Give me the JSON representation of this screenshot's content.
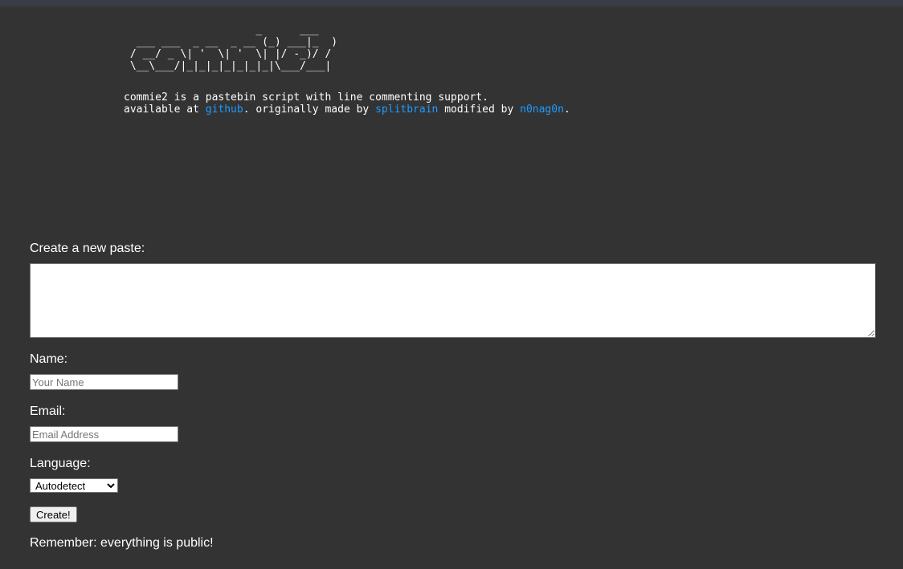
{
  "header": {
    "ascii_logo": "                     _      ___\n  ___ ___  _ __  _ __ (_) ___|_  )\n / __/ _ \\| '  \\| '  \\| |/ -_)/ /\n \\__\\___/|_|_|_|_|_|_|_|\\___/___|",
    "intro_line1": "commie2 is a pastebin script with line commenting support.",
    "intro_line2_prefix": "available at ",
    "github_link": "github",
    "intro_line2_mid1": ". originally made by ",
    "splitbrain_link": "splitbrain",
    "intro_line2_mid2": " modified by ",
    "n0nag0n_link": "n0nag0n",
    "intro_line2_suffix": "."
  },
  "form": {
    "paste_label": "Create a new paste:",
    "paste_value": "",
    "name_label": "Name:",
    "name_placeholder": "Your Name",
    "email_label": "Email:",
    "email_placeholder": "Email Address",
    "language_label": "Language:",
    "language_selected": "Autodetect",
    "create_button": "Create!",
    "notice": "Remember: everything is public!"
  },
  "colors": {
    "background": "#333333",
    "link": "#1e9bff",
    "text": "#ffffff"
  }
}
